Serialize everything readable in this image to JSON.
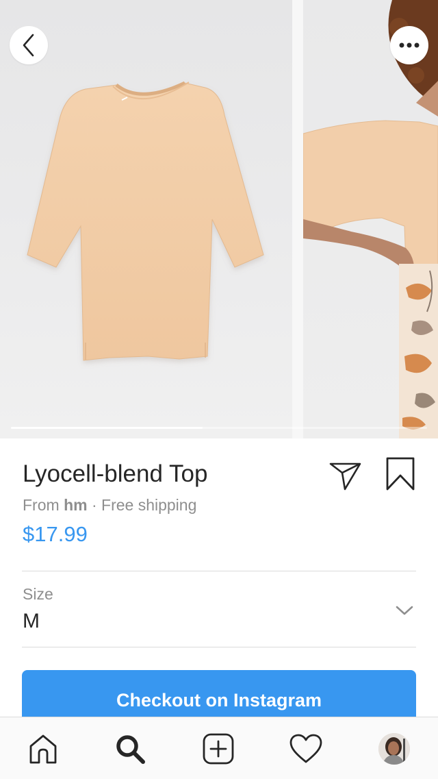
{
  "product": {
    "title": "Lyocell-blend Top",
    "from_prefix": "From ",
    "merchant": "hm",
    "separator": " · ",
    "shipping": "Free shipping",
    "price": "$17.99"
  },
  "carousel": {
    "image_count": 2,
    "current_index": 1,
    "progress_fraction": 0.46
  },
  "size": {
    "label": "Size",
    "selected": "M"
  },
  "checkout": {
    "label": "Checkout on Instagram"
  },
  "icons": {
    "back": "chevron-left-icon",
    "more": "more-horizontal-icon",
    "share": "paper-plane-icon",
    "save": "bookmark-icon",
    "dropdown": "chevron-down-icon",
    "home": "home-icon",
    "search": "search-icon",
    "new_post": "plus-square-icon",
    "activity": "heart-icon",
    "profile": "avatar"
  },
  "colors": {
    "accent": "#3897f0",
    "text": "#262626",
    "secondary_text": "#8e8e8e",
    "divider": "#dbdbdb",
    "shirt": "#f2ceaa"
  }
}
